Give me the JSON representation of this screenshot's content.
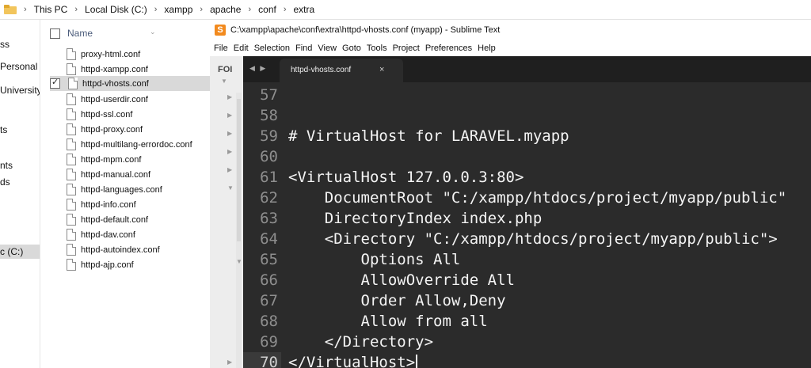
{
  "explorer": {
    "breadcrumb": [
      "This PC",
      "Local Disk (C:)",
      "xampp",
      "apache",
      "conf",
      "extra"
    ],
    "nav_items": [
      "ss",
      "Personal",
      "University",
      "ts",
      "nts",
      "ds",
      "c (C:)"
    ],
    "column_name": "Name",
    "files": [
      "proxy-html.conf",
      "httpd-xampp.conf",
      "httpd-vhosts.conf",
      "httpd-userdir.conf",
      "httpd-ssl.conf",
      "httpd-proxy.conf",
      "httpd-multilang-errordoc.conf",
      "httpd-mpm.conf",
      "httpd-manual.conf",
      "httpd-languages.conf",
      "httpd-info.conf",
      "httpd-default.conf",
      "httpd-dav.conf",
      "httpd-autoindex.conf",
      "httpd-ajp.conf"
    ],
    "selected_file": "httpd-vhosts.conf"
  },
  "sublime": {
    "title": "C:\\xampp\\apache\\conf\\extra\\httpd-vhosts.conf (myapp) - Sublime Text",
    "menu": [
      "File",
      "Edit",
      "Selection",
      "Find",
      "View",
      "Goto",
      "Tools",
      "Project",
      "Preferences",
      "Help"
    ],
    "sidebar_header": "FOI",
    "tab_nav": "◀ ▶",
    "tab_label": "httpd-vhosts.conf",
    "tab_close": "×",
    "lines": [
      {
        "num": "57",
        "text": ""
      },
      {
        "num": "58",
        "text": ""
      },
      {
        "num": "59",
        "text": "# VirtualHost for LARAVEL.myapp"
      },
      {
        "num": "60",
        "text": ""
      },
      {
        "num": "61",
        "text": "<VirtualHost 127.0.0.3:80>"
      },
      {
        "num": "62",
        "text": "    DocumentRoot \"C:/xampp/htdocs/project/myapp/public\""
      },
      {
        "num": "63",
        "text": "    DirectoryIndex index.php"
      },
      {
        "num": "64",
        "text": "    <Directory \"C:/xampp/htdocs/project/myapp/public\">"
      },
      {
        "num": "65",
        "text": "        Options All"
      },
      {
        "num": "66",
        "text": "        AllowOverride All"
      },
      {
        "num": "67",
        "text": "        Order Allow,Deny"
      },
      {
        "num": "68",
        "text": "        Allow from all"
      },
      {
        "num": "69",
        "text": "    </Directory>"
      },
      {
        "num": "70",
        "text": "</VirtualHost>"
      }
    ],
    "current_line": "70"
  }
}
